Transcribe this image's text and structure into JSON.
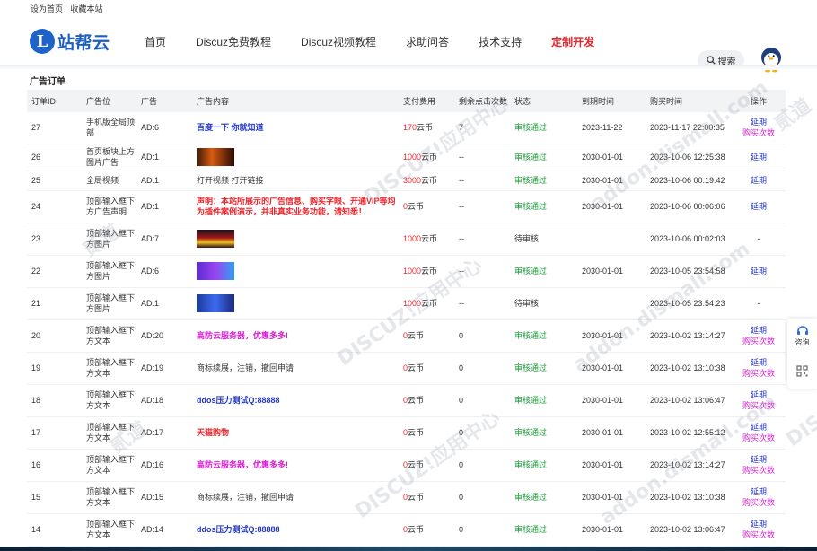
{
  "topbar": {
    "set_home": "设为首页",
    "bookmark": "收藏本站"
  },
  "logo": {
    "mark": "L",
    "text": "站帮云"
  },
  "nav": [
    {
      "label": "首页",
      "highlight": false
    },
    {
      "label": "Discuz免费教程",
      "highlight": false
    },
    {
      "label": "Discuz视频教程",
      "highlight": false
    },
    {
      "label": "求助问答",
      "highlight": false
    },
    {
      "label": "技术支持",
      "highlight": false
    },
    {
      "label": "定制开发",
      "highlight": true
    }
  ],
  "search": {
    "label": "搜索"
  },
  "page_title": "广告订单",
  "table": {
    "headers": [
      "订单ID",
      "广告位",
      "广告",
      "广告内容",
      "支付费用",
      "剩余点击次数",
      "状态",
      "到期时间",
      "购买时间",
      "操作"
    ],
    "rows": [
      {
        "id": "27",
        "position": "手机版全局顶部",
        "ad": "AD:6",
        "content_type": "text",
        "content": "百度一下 你就知道",
        "style": "blue",
        "fee_num": "170",
        "fee_unit": "云币",
        "clicks": "7",
        "status": "审核通过",
        "status_ok": true,
        "expire": "2023-11-22",
        "buy_time": "2023-11-17 22:00:35",
        "ops": [
          "延期",
          "购买次数"
        ]
      },
      {
        "id": "26",
        "position": "首页板块上方图片广告",
        "ad": "AD:1",
        "content_type": "image",
        "thumb": "a",
        "fee_num": "1000",
        "fee_unit": "云币",
        "clicks": "--",
        "status": "审核通过",
        "status_ok": true,
        "expire": "2030-01-01",
        "buy_time": "2023-10-06 12:25:38",
        "ops": [
          "延期"
        ]
      },
      {
        "id": "25",
        "position": "全局视频",
        "ad": "AD:1",
        "content_type": "text",
        "content": "打开视频 打开链接",
        "style": "plain",
        "fee_num": "3000",
        "fee_unit": "云币",
        "clicks": "--",
        "status": "审核通过",
        "status_ok": true,
        "expire": "2030-01-01",
        "buy_time": "2023-10-06 00:19:42",
        "ops": [
          "延期"
        ]
      },
      {
        "id": "24",
        "position": "顶部输入框下方广告声明",
        "ad": "AD:1",
        "content_type": "text",
        "content": "声明：本站所展示的广告信息、购买字眼、开通VIP等均为插件案例演示，并非真实业务功能，请知悉！",
        "style": "red",
        "fee_num": "0",
        "fee_unit": "云币",
        "clicks": "--",
        "status": "审核通过",
        "status_ok": true,
        "expire": "2030-01-01",
        "buy_time": "2023-10-06 00:06:06",
        "ops": [
          "延期"
        ]
      },
      {
        "id": "23",
        "position": "顶部输入框下方图片",
        "ad": "AD:7",
        "content_type": "image",
        "thumb": "b",
        "fee_num": "1000",
        "fee_unit": "云币",
        "clicks": "--",
        "status": "待审核",
        "status_ok": false,
        "expire": "",
        "buy_time": "2023-10-06 00:02:03",
        "ops": [
          "-"
        ]
      },
      {
        "id": "22",
        "position": "顶部输入框下方图片",
        "ad": "AD:6",
        "content_type": "image",
        "thumb": "c",
        "fee_num": "1000",
        "fee_unit": "云币",
        "clicks": "--",
        "status": "审核通过",
        "status_ok": true,
        "expire": "2030-01-01",
        "buy_time": "2023-10-05 23:54:58",
        "ops": [
          "延期"
        ]
      },
      {
        "id": "21",
        "position": "顶部输入框下方图片",
        "ad": "AD:1",
        "content_type": "image",
        "thumb": "d",
        "fee_num": "1000",
        "fee_unit": "云币",
        "clicks": "--",
        "status": "待审核",
        "status_ok": false,
        "expire": "",
        "buy_time": "2023-10-05 23:54:23",
        "ops": [
          "-"
        ]
      },
      {
        "id": "20",
        "position": "顶部输入框下方文本",
        "ad": "AD:20",
        "content_type": "text",
        "content": "高防云服务器，优惠多多!",
        "style": "pink",
        "fee_num": "0",
        "fee_unit": "云币",
        "clicks": "0",
        "status": "审核通过",
        "status_ok": true,
        "expire": "2030-01-01",
        "buy_time": "2023-10-02 13:14:27",
        "ops": [
          "延期",
          "购买次数"
        ]
      },
      {
        "id": "19",
        "position": "顶部输入框下方文本",
        "ad": "AD:19",
        "content_type": "text",
        "content": "商标续展，注销，撤回申请",
        "style": "plain",
        "fee_num": "0",
        "fee_unit": "云币",
        "clicks": "0",
        "status": "审核通过",
        "status_ok": true,
        "expire": "2030-01-01",
        "buy_time": "2023-10-02 13:10:38",
        "ops": [
          "延期",
          "购买次数"
        ]
      },
      {
        "id": "18",
        "position": "顶部输入框下方文本",
        "ad": "AD:18",
        "content_type": "text",
        "content": "ddos压力测试Q:88888",
        "style": "blue",
        "fee_num": "0",
        "fee_unit": "云币",
        "clicks": "0",
        "status": "审核通过",
        "status_ok": true,
        "expire": "2030-01-01",
        "buy_time": "2023-10-02 13:06:47",
        "ops": [
          "延期",
          "购买次数"
        ]
      },
      {
        "id": "17",
        "position": "顶部输入框下方文本",
        "ad": "AD:17",
        "content_type": "text",
        "content": "天猫购物",
        "style": "red",
        "fee_num": "0",
        "fee_unit": "云币",
        "clicks": "0",
        "status": "审核通过",
        "status_ok": true,
        "expire": "2030-01-01",
        "buy_time": "2023-10-02 12:55:12",
        "ops": [
          "延期",
          "购买次数"
        ]
      },
      {
        "id": "16",
        "position": "顶部输入框下方文本",
        "ad": "AD:16",
        "content_type": "text",
        "content": "高防云服务器，优惠多多!",
        "style": "pink",
        "fee_num": "0",
        "fee_unit": "云币",
        "clicks": "0",
        "status": "审核通过",
        "status_ok": true,
        "expire": "2030-01-01",
        "buy_time": "2023-10-02 13:14:27",
        "ops": [
          "延期",
          "购买次数"
        ]
      },
      {
        "id": "15",
        "position": "顶部输入框下方文本",
        "ad": "AD:15",
        "content_type": "text",
        "content": "商标续展，注销，撤回申请",
        "style": "plain",
        "fee_num": "0",
        "fee_unit": "云币",
        "clicks": "0",
        "status": "审核通过",
        "status_ok": true,
        "expire": "2030-01-01",
        "buy_time": "2023-10-02 13:10:38",
        "ops": [
          "延期",
          "购买次数"
        ]
      },
      {
        "id": "14",
        "position": "顶部输入框下方文本",
        "ad": "AD:14",
        "content_type": "text",
        "content": "ddos压力测试Q:88888",
        "style": "blue",
        "fee_num": "0",
        "fee_unit": "云币",
        "clicks": "0",
        "status": "审核通过",
        "status_ok": true,
        "expire": "2030-01-01",
        "buy_time": "2023-10-02 13:06:47",
        "ops": [
          "延期",
          "购买次数"
        ]
      }
    ]
  },
  "side": {
    "consult": "咨询"
  },
  "watermark": [
    "DISCUZ!应用中心",
    "addon.dismall.com",
    "贰道"
  ]
}
